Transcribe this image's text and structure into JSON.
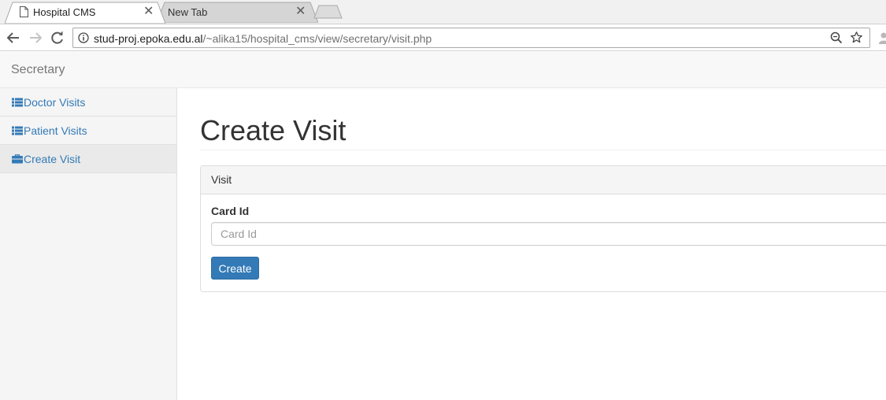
{
  "browser": {
    "tabs": [
      {
        "title": "Hospital CMS",
        "active": true
      },
      {
        "title": "New Tab",
        "active": false
      }
    ],
    "url_host": "stud-proj.epoka.edu.al",
    "url_path": "/~alika15/hospital_cms/view/secretary/visit.php"
  },
  "navbar": {
    "brand": "Secretary"
  },
  "sidebar": {
    "items": [
      {
        "label": "Doctor Visits",
        "icon": "list-icon",
        "active": false
      },
      {
        "label": "Patient Visits",
        "icon": "list-icon",
        "active": false
      },
      {
        "label": "Create Visit",
        "icon": "briefcase-icon",
        "active": true
      }
    ]
  },
  "main": {
    "title": "Create Visit",
    "panel": {
      "heading": "Visit",
      "field_label": "Card Id",
      "field_placeholder": "Card Id",
      "submit_label": "Create"
    }
  },
  "colors": {
    "link": "#337ab7",
    "primary_button": "#337ab7"
  }
}
